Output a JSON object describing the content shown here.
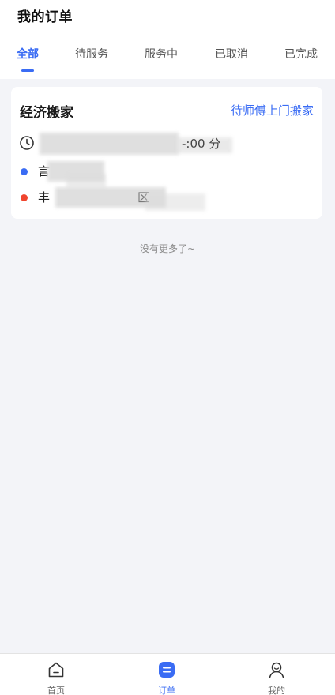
{
  "header": {
    "title": "我的订单",
    "tabs": [
      {
        "label": "全部",
        "active": true
      },
      {
        "label": "待服务",
        "active": false
      },
      {
        "label": "服务中",
        "active": false
      },
      {
        "label": "已取消",
        "active": false
      },
      {
        "label": "已完成",
        "active": false
      }
    ]
  },
  "orders": [
    {
      "type": "经济搬家",
      "status": "待师傅上门搬家",
      "time_visible_text": "-:00 分",
      "start_visible_text": "言",
      "end_visible_text": "丰",
      "end_tail_text": "区"
    }
  ],
  "list_footer": "没有更多了~",
  "bottom_nav": [
    {
      "label": "首页",
      "icon": "home-icon",
      "active": false
    },
    {
      "label": "订单",
      "icon": "orders-icon",
      "active": true
    },
    {
      "label": "我的",
      "icon": "profile-icon",
      "active": false
    }
  ],
  "colors": {
    "accent": "#3a6cf4",
    "start_dot": "#3a6cf4",
    "end_dot": "#f0452e",
    "background": "#f3f4f8"
  }
}
